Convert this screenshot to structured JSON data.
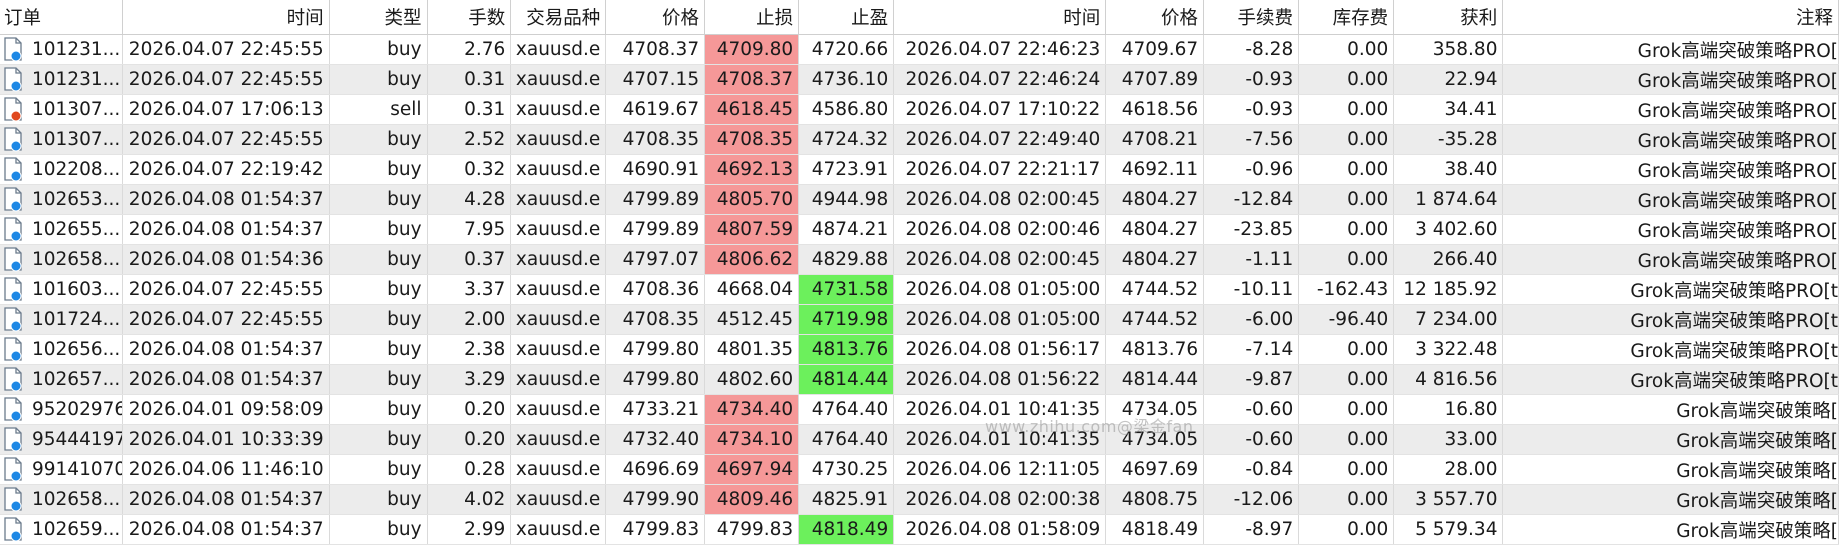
{
  "columns": [
    "订单",
    "时间",
    "类型",
    "手数",
    "交易品种",
    "价格",
    "止损",
    "止盈",
    "时间",
    "价格",
    "手续费",
    "库存费",
    "获利",
    "注释"
  ],
  "watermark": "www.zhihu.com@梁金fan",
  "rows": [
    {
      "order": "101231...",
      "icon": "buy-order-icon",
      "open_time": "2026.04.07 22:45:55",
      "type": "buy",
      "lots": "2.76",
      "symbol": "xauusd.e",
      "price": "4708.37",
      "sl": "4709.80",
      "sl_hit": true,
      "tp": "4720.66",
      "tp_hit": false,
      "close_time": "2026.04.07 22:46:23",
      "close_price": "4709.67",
      "commission": "-8.28",
      "swap": "0.00",
      "profit": "358.80",
      "comment": "Grok高端突破策略PRO["
    },
    {
      "order": "101231...",
      "icon": "buy-order-icon",
      "open_time": "2026.04.07 22:45:55",
      "type": "buy",
      "lots": "0.31",
      "symbol": "xauusd.e",
      "price": "4707.15",
      "sl": "4708.37",
      "sl_hit": true,
      "tp": "4736.10",
      "tp_hit": false,
      "close_time": "2026.04.07 22:46:24",
      "close_price": "4707.89",
      "commission": "-0.93",
      "swap": "0.00",
      "profit": "22.94",
      "comment": "Grok高端突破策略PRO["
    },
    {
      "order": "101307...",
      "icon": "sell-order-icon",
      "open_time": "2026.04.07 17:06:13",
      "type": "sell",
      "lots": "0.31",
      "symbol": "xauusd.e",
      "price": "4619.67",
      "sl": "4618.45",
      "sl_hit": true,
      "tp": "4586.80",
      "tp_hit": false,
      "close_time": "2026.04.07 17:10:22",
      "close_price": "4618.56",
      "commission": "-0.93",
      "swap": "0.00",
      "profit": "34.41",
      "comment": "Grok高端突破策略PRO["
    },
    {
      "order": "101307...",
      "icon": "buy-order-icon",
      "open_time": "2026.04.07 22:45:55",
      "type": "buy",
      "lots": "2.52",
      "symbol": "xauusd.e",
      "price": "4708.35",
      "sl": "4708.35",
      "sl_hit": true,
      "tp": "4724.32",
      "tp_hit": false,
      "close_time": "2026.04.07 22:49:40",
      "close_price": "4708.21",
      "commission": "-7.56",
      "swap": "0.00",
      "profit": "-35.28",
      "comment": "Grok高端突破策略PRO["
    },
    {
      "order": "102208...",
      "icon": "buy-order-icon",
      "open_time": "2026.04.07 22:19:42",
      "type": "buy",
      "lots": "0.32",
      "symbol": "xauusd.e",
      "price": "4690.91",
      "sl": "4692.13",
      "sl_hit": true,
      "tp": "4723.91",
      "tp_hit": false,
      "close_time": "2026.04.07 22:21:17",
      "close_price": "4692.11",
      "commission": "-0.96",
      "swap": "0.00",
      "profit": "38.40",
      "comment": "Grok高端突破策略PRO["
    },
    {
      "order": "102653...",
      "icon": "buy-order-icon",
      "open_time": "2026.04.08 01:54:37",
      "type": "buy",
      "lots": "4.28",
      "symbol": "xauusd.e",
      "price": "4799.89",
      "sl": "4805.70",
      "sl_hit": true,
      "tp": "4944.98",
      "tp_hit": false,
      "close_time": "2026.04.08 02:00:45",
      "close_price": "4804.27",
      "commission": "-12.84",
      "swap": "0.00",
      "profit": "1 874.64",
      "comment": "Grok高端突破策略PRO["
    },
    {
      "order": "102655...",
      "icon": "buy-order-icon",
      "open_time": "2026.04.08 01:54:37",
      "type": "buy",
      "lots": "7.95",
      "symbol": "xauusd.e",
      "price": "4799.89",
      "sl": "4807.59",
      "sl_hit": true,
      "tp": "4874.21",
      "tp_hit": false,
      "close_time": "2026.04.08 02:00:46",
      "close_price": "4804.27",
      "commission": "-23.85",
      "swap": "0.00",
      "profit": "3 402.60",
      "comment": "Grok高端突破策略PRO["
    },
    {
      "order": "102658...",
      "icon": "buy-order-icon",
      "open_time": "2026.04.08 01:54:36",
      "type": "buy",
      "lots": "0.37",
      "symbol": "xauusd.e",
      "price": "4797.07",
      "sl": "4806.62",
      "sl_hit": true,
      "tp": "4829.88",
      "tp_hit": false,
      "close_time": "2026.04.08 02:00:45",
      "close_price": "4804.27",
      "commission": "-1.11",
      "swap": "0.00",
      "profit": "266.40",
      "comment": "Grok高端突破策略PRO["
    },
    {
      "order": "101603...",
      "icon": "buy-order-icon",
      "open_time": "2026.04.07 22:45:55",
      "type": "buy",
      "lots": "3.37",
      "symbol": "xauusd.e",
      "price": "4708.36",
      "sl": "4668.04",
      "sl_hit": false,
      "tp": "4731.58",
      "tp_hit": true,
      "close_time": "2026.04.08 01:05:00",
      "close_price": "4744.52",
      "commission": "-10.11",
      "swap": "-162.43",
      "profit": "12 185.92",
      "comment": "Grok高端突破策略PRO[t"
    },
    {
      "order": "101724...",
      "icon": "buy-order-icon",
      "open_time": "2026.04.07 22:45:55",
      "type": "buy",
      "lots": "2.00",
      "symbol": "xauusd.e",
      "price": "4708.35",
      "sl": "4512.45",
      "sl_hit": false,
      "tp": "4719.98",
      "tp_hit": true,
      "close_time": "2026.04.08 01:05:00",
      "close_price": "4744.52",
      "commission": "-6.00",
      "swap": "-96.40",
      "profit": "7 234.00",
      "comment": "Grok高端突破策略PRO[t"
    },
    {
      "order": "102656...",
      "icon": "buy-order-icon",
      "open_time": "2026.04.08 01:54:37",
      "type": "buy",
      "lots": "2.38",
      "symbol": "xauusd.e",
      "price": "4799.80",
      "sl": "4801.35",
      "sl_hit": false,
      "tp": "4813.76",
      "tp_hit": true,
      "close_time": "2026.04.08 01:56:17",
      "close_price": "4813.76",
      "commission": "-7.14",
      "swap": "0.00",
      "profit": "3 322.48",
      "comment": "Grok高端突破策略PRO[t"
    },
    {
      "order": "102657...",
      "icon": "buy-order-icon",
      "open_time": "2026.04.08 01:54:37",
      "type": "buy",
      "lots": "3.29",
      "symbol": "xauusd.e",
      "price": "4799.80",
      "sl": "4802.60",
      "sl_hit": false,
      "tp": "4814.44",
      "tp_hit": true,
      "close_time": "2026.04.08 01:56:22",
      "close_price": "4814.44",
      "commission": "-9.87",
      "swap": "0.00",
      "profit": "4 816.56",
      "comment": "Grok高端突破策略PRO[t"
    },
    {
      "order": "95202976",
      "icon": "buy-order-icon",
      "open_time": "2026.04.01 09:58:09",
      "type": "buy",
      "lots": "0.20",
      "symbol": "xauusd.e",
      "price": "4733.21",
      "sl": "4734.40",
      "sl_hit": true,
      "tp": "4764.40",
      "tp_hit": false,
      "close_time": "2026.04.01 10:41:35",
      "close_price": "4734.05",
      "commission": "-0.60",
      "swap": "0.00",
      "profit": "16.80",
      "comment": "Grok高端突破策略["
    },
    {
      "order": "95444197",
      "icon": "buy-order-icon",
      "open_time": "2026.04.01 10:33:39",
      "type": "buy",
      "lots": "0.20",
      "symbol": "xauusd.e",
      "price": "4732.40",
      "sl": "4734.10",
      "sl_hit": true,
      "tp": "4764.40",
      "tp_hit": false,
      "close_time": "2026.04.01 10:41:35",
      "close_price": "4734.05",
      "commission": "-0.60",
      "swap": "0.00",
      "profit": "33.00",
      "comment": "Grok高端突破策略["
    },
    {
      "order": "99141070",
      "icon": "buy-order-icon",
      "open_time": "2026.04.06 11:46:10",
      "type": "buy",
      "lots": "0.28",
      "symbol": "xauusd.e",
      "price": "4696.69",
      "sl": "4697.94",
      "sl_hit": true,
      "tp": "4730.25",
      "tp_hit": false,
      "close_time": "2026.04.06 12:11:05",
      "close_price": "4697.69",
      "commission": "-0.84",
      "swap": "0.00",
      "profit": "28.00",
      "comment": "Grok高端突破策略["
    },
    {
      "order": "102658...",
      "icon": "buy-order-icon",
      "open_time": "2026.04.08 01:54:37",
      "type": "buy",
      "lots": "4.02",
      "symbol": "xauusd.e",
      "price": "4799.90",
      "sl": "4809.46",
      "sl_hit": true,
      "tp": "4825.91",
      "tp_hit": false,
      "close_time": "2026.04.08 02:00:38",
      "close_price": "4808.75",
      "commission": "-12.06",
      "swap": "0.00",
      "profit": "3 557.70",
      "comment": "Grok高端突破策略["
    },
    {
      "order": "102659...",
      "icon": "buy-order-icon",
      "open_time": "2026.04.08 01:54:37",
      "type": "buy",
      "lots": "2.99",
      "symbol": "xauusd.e",
      "price": "4799.83",
      "sl": "4799.83",
      "sl_hit": false,
      "tp": "4818.49",
      "tp_hit": true,
      "close_time": "2026.04.08 01:58:09",
      "close_price": "4818.49",
      "commission": "-8.97",
      "swap": "0.00",
      "profit": "5 579.34",
      "comment": "Grok高端突破策略["
    }
  ]
}
